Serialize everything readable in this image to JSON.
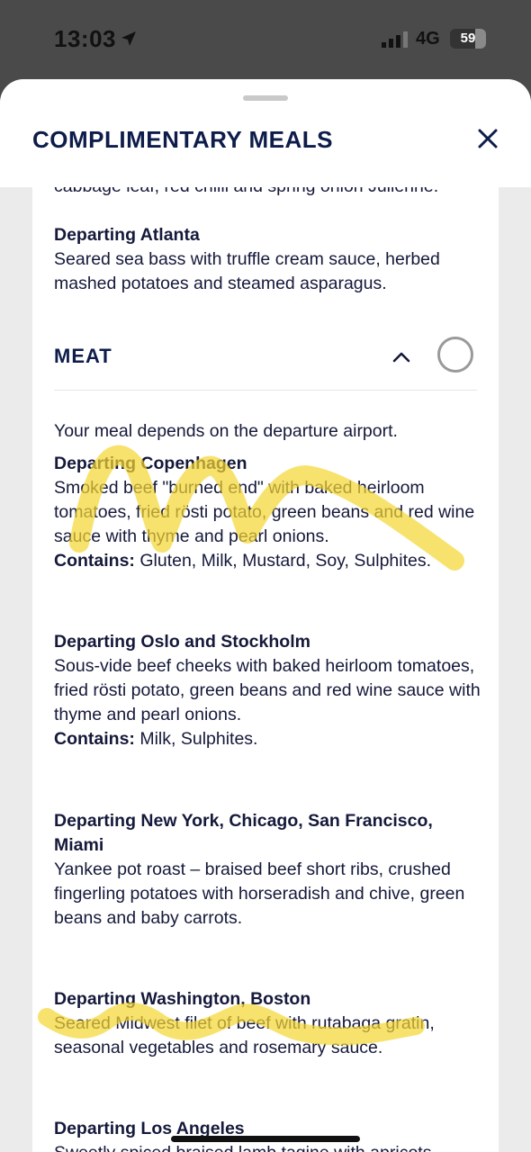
{
  "status_bar": {
    "time": "13:03",
    "network": "4G",
    "battery": "59"
  },
  "sheet": {
    "title": "COMPLIMENTARY MEALS"
  },
  "previous_section": {
    "cut_line": "cabbage leaf, red chilli and spring onion Julienne.",
    "item": {
      "departure": "Departing Atlanta",
      "description": "Seared sea bass with truffle cream sauce, herbed mashed potatoes and steamed asparagus."
    }
  },
  "meat_section": {
    "title": "MEAT",
    "intro": "Your meal depends on the departure airport.",
    "items": [
      {
        "departure": "Departing Copenhagen",
        "description": "Smoked beef \"burned end\" with baked heirloom tomatoes, fried rösti potato, green beans and red wine sauce with thyme and pearl onions.",
        "contains_label": "Contains:",
        "contains": "Gluten, Milk, Mustard, Soy, Sulphites."
      },
      {
        "departure": "Departing Oslo and Stockholm",
        "description": "Sous-vide beef cheeks with baked heirloom tomatoes, fried rösti potato, green beans and red wine sauce with thyme and pearl onions.",
        "contains_label": "Contains:",
        "contains": "Milk, Sulphites."
      },
      {
        "departure": "Departing New York, Chicago, San Francisco, Miami",
        "description": "Yankee pot roast – braised beef short ribs, crushed fingerling potatoes with horseradish and chive, green beans and baby carrots."
      },
      {
        "departure": "Departing Washington, Boston",
        "description": "Seared Midwest filet of beef with rutabaga gratin, seasonal vegetables and rosemary sauce."
      },
      {
        "departure": "Departing Los Angeles",
        "description": "Sweetly spiced braised lamb tagine with apricots"
      }
    ]
  },
  "colors": {
    "navy": "#0d1c4a",
    "highlighter": "#f5d531"
  }
}
